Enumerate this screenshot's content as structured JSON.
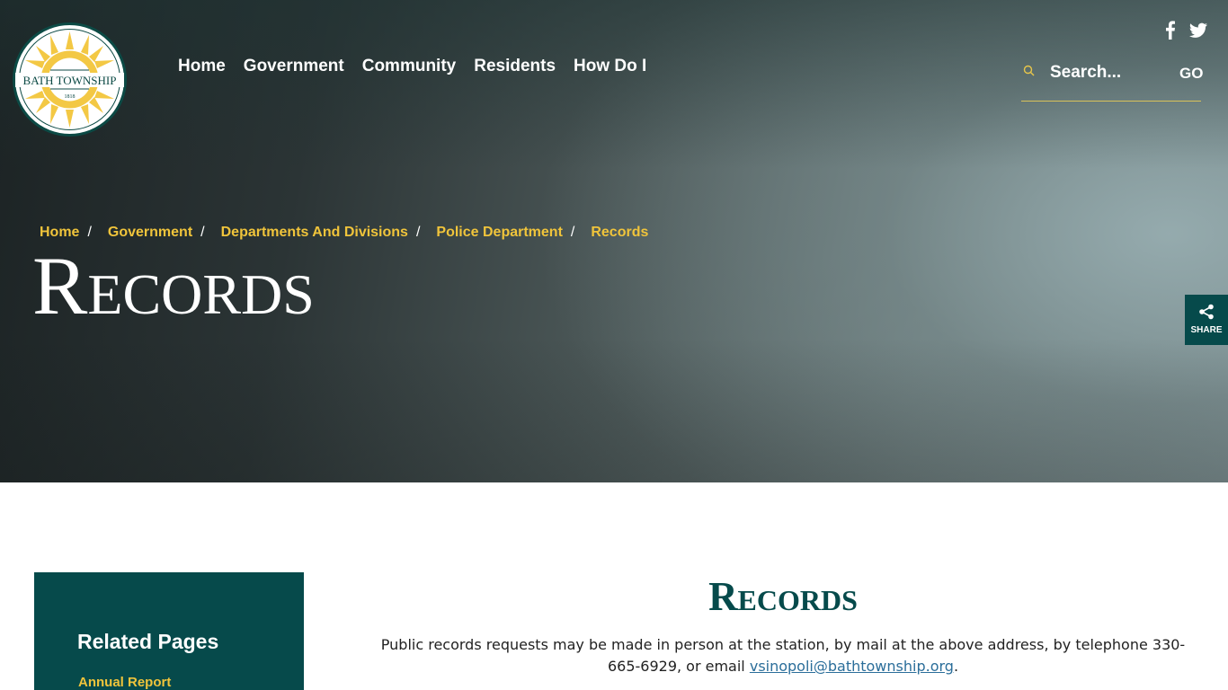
{
  "logo": {
    "name": "BATH TOWNSHIP",
    "year": "1818"
  },
  "nav": {
    "items": [
      "Home",
      "Government",
      "Community",
      "Residents",
      "How Do I"
    ]
  },
  "social": {
    "facebook_icon": "facebook-icon",
    "twitter_icon": "twitter-icon"
  },
  "search": {
    "placeholder": "Search...",
    "go_label": "GO"
  },
  "breadcrumb": [
    "Home",
    "Government",
    "Departments And Divisions",
    "Police Department",
    "Records"
  ],
  "breadcrumb_sep": "/",
  "hero": {
    "title": "Records"
  },
  "share": {
    "label": "SHARE"
  },
  "sidebar": {
    "heading": "Related Pages",
    "links": [
      "Annual Report"
    ]
  },
  "main": {
    "title": "Records",
    "text_before": "Public records requests may be made in person at the station, by mail at the above address, by telephone 330-665-6929, or email ",
    "email": "vsinopoli@bathtownship.org",
    "text_after": "."
  },
  "colors": {
    "brand_teal": "#064a4b",
    "accent_gold": "#f0c43b",
    "link_blue": "#2b6e9a"
  }
}
